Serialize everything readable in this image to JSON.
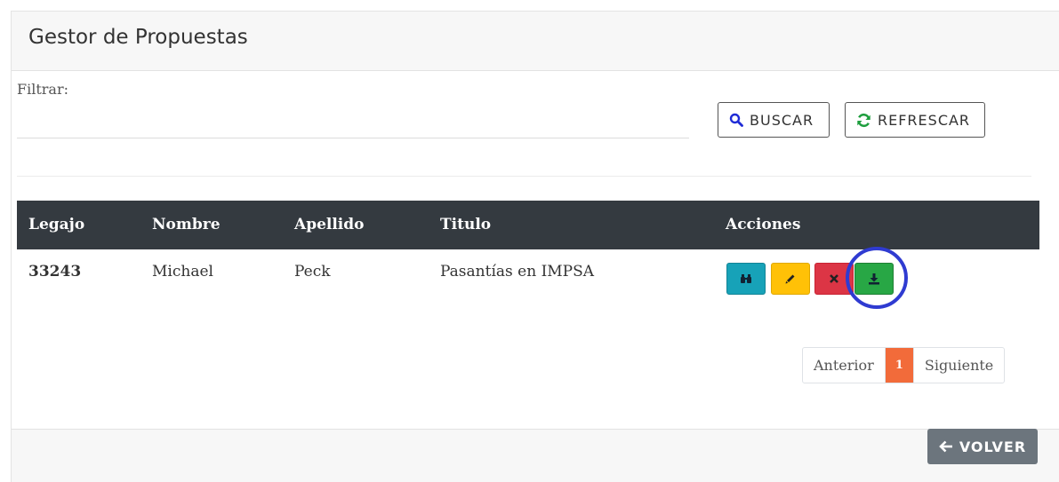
{
  "header": {
    "title": "Gestor de Propuestas"
  },
  "filter": {
    "label": "Filtrar:",
    "value": "",
    "placeholder": ""
  },
  "buttons": {
    "buscar": {
      "label": "BUSCAR",
      "icon": "search-icon"
    },
    "refrescar": {
      "label": "REFRESCAR",
      "icon": "refresh-icon"
    }
  },
  "table": {
    "columns": [
      "Legajo",
      "Nombre",
      "Apellido",
      "Titulo",
      "Acciones"
    ],
    "rows": [
      {
        "legajo": "33243",
        "nombre": "Michael",
        "apellido": "Peck",
        "titulo": "Pasantías en IMPSA"
      }
    ],
    "actions": [
      {
        "name": "view",
        "icon": "binoculars-icon",
        "color": "#17a2b8"
      },
      {
        "name": "edit",
        "icon": "pencil-icon",
        "color": "#ffc107"
      },
      {
        "name": "delete",
        "icon": "close-icon",
        "color": "#dc3545"
      },
      {
        "name": "download",
        "icon": "download-icon",
        "color": "#28a745"
      }
    ]
  },
  "pagination": {
    "prev": "Anterior",
    "current": "1",
    "next": "Siguiente",
    "accent": "#f26b3a"
  },
  "footer": {
    "back_label": "VOLVER",
    "icon": "arrow-left-icon"
  }
}
